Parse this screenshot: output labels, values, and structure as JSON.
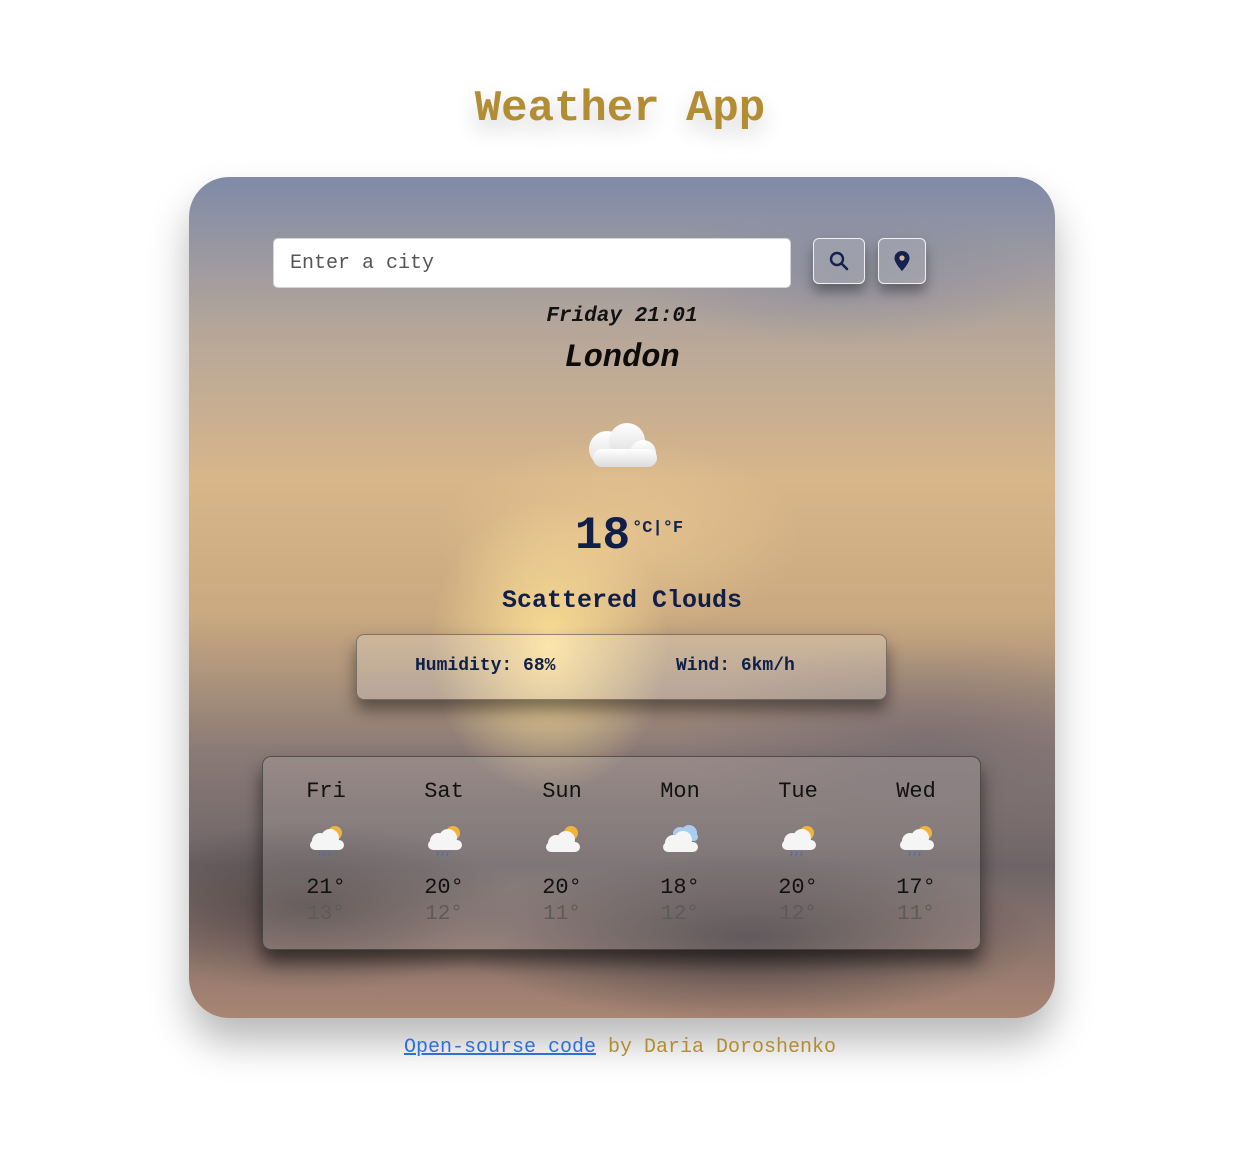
{
  "app": {
    "title": "Weather App"
  },
  "search": {
    "placeholder": "Enter a city",
    "value": ""
  },
  "buttons": {
    "search_icon": "search-icon",
    "location_icon": "map-pin-icon"
  },
  "current": {
    "datetime": "Friday 21:01",
    "city": "London",
    "icon": "cloud-icon",
    "temperature": "18",
    "unit_celsius": "°C",
    "unit_separator": "|",
    "unit_fahrenheit": "°F",
    "description": "Scattered Clouds",
    "humidity_label": "Humidity:",
    "humidity_value": "68%",
    "wind_label": "Wind:",
    "wind_value": "6km/h"
  },
  "forecast": [
    {
      "day": "Fri",
      "icon": "sun-cloud-rain-icon",
      "high": "21°",
      "low": "13°"
    },
    {
      "day": "Sat",
      "icon": "sun-cloud-rain-icon",
      "high": "20°",
      "low": "12°"
    },
    {
      "day": "Sun",
      "icon": "sun-cloud-icon",
      "high": "20°",
      "low": "11°"
    },
    {
      "day": "Mon",
      "icon": "clouds-icon",
      "high": "18°",
      "low": "12°"
    },
    {
      "day": "Tue",
      "icon": "sun-cloud-rain-icon",
      "high": "20°",
      "low": "12°"
    },
    {
      "day": "Wed",
      "icon": "sun-cloud-rain-icon",
      "high": "17°",
      "low": "11°"
    }
  ],
  "footer": {
    "link_text": "Open-sourse code",
    "author_text": " by Daria Doroshenko"
  },
  "colors": {
    "title": "#b38d34",
    "accent_text": "#0f1f4a",
    "link": "#2f6fdc"
  }
}
